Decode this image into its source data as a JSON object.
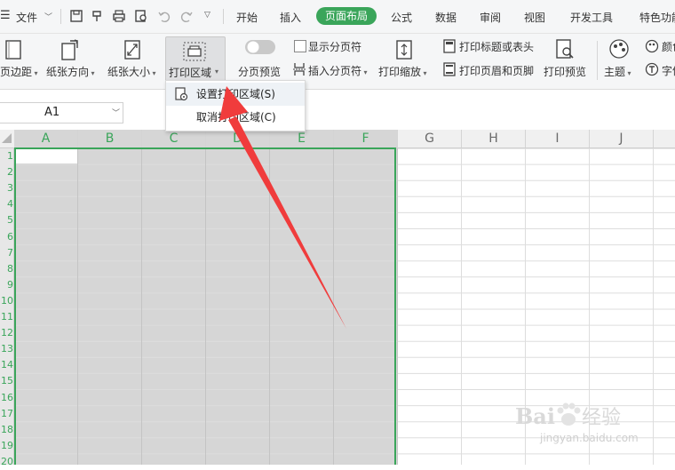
{
  "menubar": {
    "hamburger": "☰",
    "file": "文件",
    "tabs": [
      "开始",
      "插入",
      "页面布局",
      "公式",
      "数据",
      "审阅",
      "视图",
      "开发工具",
      "特色功能"
    ],
    "active_tab": "页面布局"
  },
  "ribbon": {
    "margins": "页边距",
    "orientation": "纸张方向",
    "size": "纸张大小",
    "print_area": "打印区域",
    "page_break_preview": "分页预览",
    "show_page_breaks": "显示分页符",
    "insert_page_break": "插入分页符",
    "print_scale": "打印缩放",
    "print_titles": "打印标题或表头",
    "print_header_footer": "打印页眉和页脚",
    "print_preview": "打印预览",
    "theme": "主题",
    "colors": "颜色",
    "fonts": "字体"
  },
  "dropdown": {
    "set_print_area": "设置打印区域(S)",
    "clear_print_area": "取消打印区域(C)"
  },
  "formula_bar": {
    "name_box": "A1"
  },
  "grid": {
    "columns": [
      "A",
      "B",
      "C",
      "D",
      "E",
      "F",
      "G",
      "H",
      "I",
      "J"
    ],
    "rows": [
      "1",
      "2",
      "3",
      "4",
      "5",
      "6",
      "7",
      "8",
      "9",
      "10",
      "11",
      "12",
      "13",
      "14",
      "15",
      "16",
      "17",
      "18",
      "19",
      "20"
    ]
  },
  "watermark": {
    "brand": "Bai",
    "brand2": "经验",
    "url": "jingyan.baidu.com"
  },
  "colors": {
    "accent_green": "#3aa55a",
    "arrow_red": "#f03c3c",
    "selection_gray": "#d6d6d6"
  }
}
